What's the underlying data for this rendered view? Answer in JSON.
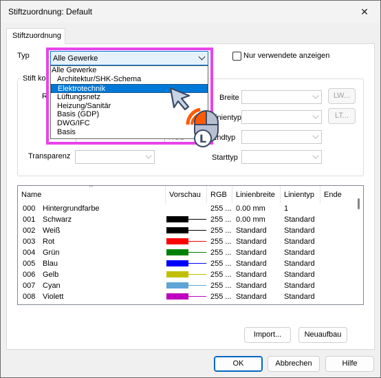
{
  "window": {
    "title": "Stiftzuordnung: Default",
    "close_glyph": "✕"
  },
  "tab": {
    "label": "Stiftzuordnung"
  },
  "typ": {
    "label": "Typ",
    "selected": "Alle Gewerke",
    "options": [
      "Alle Gewerke",
      "Architektur/SHK-Schema",
      "Elektrotechnik",
      "Lüftungsnetz",
      "Heizung/Sanitär",
      "Basis (GDP)",
      "DWG/IFC",
      "Basis"
    ],
    "highlighted_option": "Elektrotechnik",
    "highlight_color": "#e844e8"
  },
  "only_used": {
    "label": "Nur verwendete anzeigen",
    "checked": false
  },
  "stift": {
    "group_label": "Stift kor",
    "r_label": "R",
    "rgb_label": "RGB",
    "transparenz_label": "Transparenz",
    "breite_label": "Breite",
    "linientyp_label": "Linientyp",
    "endtyp_label": "Endtyp",
    "starttyp_label": "Starttyp",
    "lw_button": "LW...",
    "lt_button": "LT..."
  },
  "table": {
    "columns": [
      "Name",
      "Vorschau",
      "RGB",
      "Linienbreite",
      "Linientyp",
      "Ende"
    ],
    "rows": [
      {
        "num": "000",
        "name": "Hintergrundfarbe",
        "color": "",
        "rgb": "255 ...",
        "width": "0.00 mm",
        "type": "1"
      },
      {
        "num": "001",
        "name": "Schwarz",
        "color": "#000000",
        "rgb": "255 ...",
        "width": "0.00 mm",
        "type": "Standard"
      },
      {
        "num": "002",
        "name": "Weiß",
        "color": "#000000",
        "rgb": "255 ...",
        "width": "Standard",
        "type": "Standard"
      },
      {
        "num": "003",
        "name": "Rot",
        "color": "#ff0000",
        "rgb": "255 ...",
        "width": "Standard",
        "type": "Standard"
      },
      {
        "num": "004",
        "name": "Grün",
        "color": "#008000",
        "rgb": "255 ...",
        "width": "Standard",
        "type": "Standard"
      },
      {
        "num": "005",
        "name": "Blau",
        "color": "#0000ff",
        "rgb": "255 ...",
        "width": "Standard",
        "type": "Standard"
      },
      {
        "num": "006",
        "name": "Gelb",
        "color": "#c0c000",
        "rgb": "255 ...",
        "width": "Standard",
        "type": "Standard"
      },
      {
        "num": "007",
        "name": "Cyan",
        "color": "#5ea6d6",
        "rgb": "255 ...",
        "width": "Standard",
        "type": "Standard"
      },
      {
        "num": "008",
        "name": "Violett",
        "color": "#c000c0",
        "rgb": "255 ...",
        "width": "Standard",
        "type": "Standard"
      }
    ]
  },
  "buttons": {
    "import": "Import...",
    "neuaufbau": "Neuaufbau",
    "ok": "OK",
    "abbrechen": "Abbrechen",
    "hilfe": "Hilfe"
  },
  "icons": {
    "mouse_letter": "L"
  }
}
